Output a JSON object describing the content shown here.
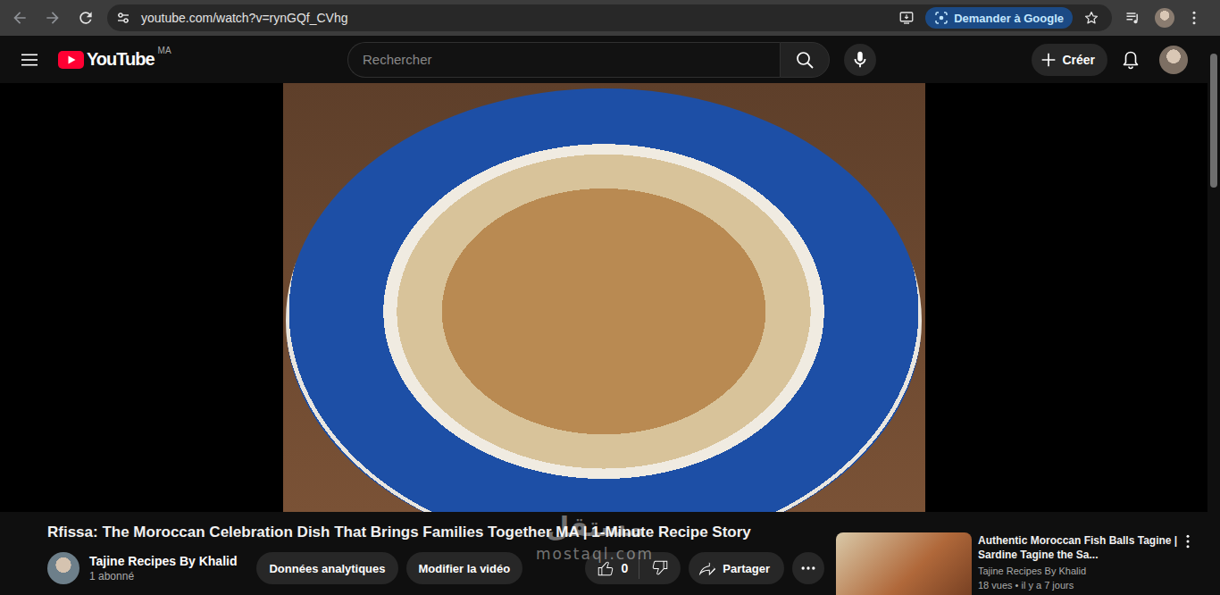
{
  "browser": {
    "url": "youtube.com/watch?v=rynGQf_CVhg",
    "ask_google": "Demander à Google"
  },
  "header": {
    "logo": "YouTube",
    "country": "MA",
    "search_placeholder": "Rechercher",
    "create": "Créer"
  },
  "video": {
    "title": "Rfissa: The Moroccan Celebration Dish That Brings Families Together MA | 1-Minute Recipe Story",
    "channel": "Tajine Recipes By Khalid",
    "subscribers": "1 abonné",
    "actions": [
      "Données analytiques",
      "Modifier la vidéo"
    ],
    "likes": "0",
    "liked": false,
    "disliked": false,
    "share": "Partager"
  },
  "recommended": [
    {
      "title": "Authentic Moroccan Fish Balls Tagine | Sardine Tagine the Sa...",
      "channel": "Tajine Recipes By Khalid",
      "meta": "18 vues • il y a 7 jours"
    }
  ],
  "watermark": {
    "arabic": "مستقل",
    "latin": "mostaql.com"
  }
}
